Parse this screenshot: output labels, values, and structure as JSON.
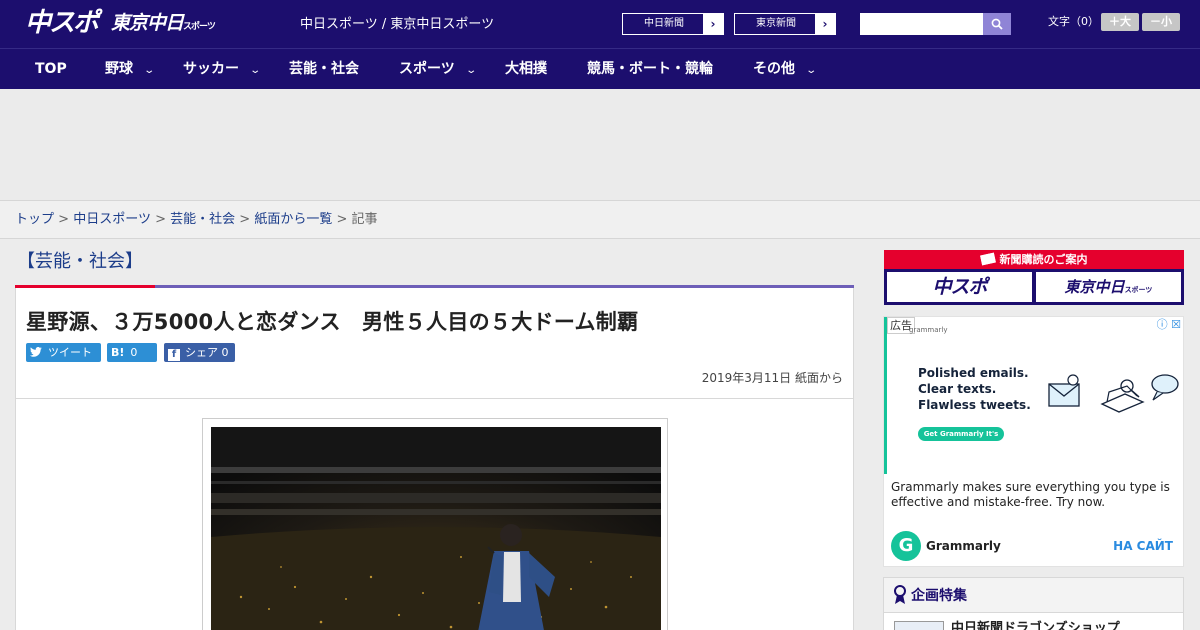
{
  "header": {
    "logo_chuspo": "中スポ",
    "logo_tokyo": "東京中日",
    "logo_tokyo_small": "スポーツ",
    "site_name": "中日スポーツ / 東京中日スポーツ",
    "paper_links": [
      "中日新聞",
      "東京新聞"
    ],
    "search_placeholder": "",
    "font_size_label": "文字（0）",
    "font_plus": "＋大",
    "font_minus": "－小"
  },
  "nav": {
    "items": [
      {
        "label": "TOP",
        "has_dropdown": false
      },
      {
        "label": "野球",
        "has_dropdown": true
      },
      {
        "label": "サッカー",
        "has_dropdown": true
      },
      {
        "label": "芸能・社会",
        "has_dropdown": false
      },
      {
        "label": "スポーツ",
        "has_dropdown": true
      },
      {
        "label": "大相撲",
        "has_dropdown": false
      },
      {
        "label": "競馬・ボート・競輪",
        "has_dropdown": false
      },
      {
        "label": "その他",
        "has_dropdown": true
      }
    ]
  },
  "breadcrumb": {
    "items": [
      "トップ",
      "中日スポーツ",
      "芸能・社会",
      "紙面から一覧"
    ],
    "separator": ">",
    "current": "記事"
  },
  "article": {
    "category": "【芸能・社会】",
    "headline": "星野源、３万5000人と恋ダンス　男性５人目の５大ドーム制覇",
    "share": {
      "tweet_label": "ツイート",
      "hatena_icon": "B!",
      "hatena_count": "0",
      "facebook_icon": "f",
      "facebook_label": "シェア",
      "facebook_count": "0"
    },
    "date": "2019年3月11日 紙面から"
  },
  "sidebar": {
    "subscription": {
      "header": "新聞購読のご案内",
      "logo_chuspo": "中スポ",
      "logo_tokyo": "東京中日",
      "logo_tokyo_small": "スポーツ"
    },
    "ad": {
      "tag": "広告",
      "brand_small": "grammarly",
      "close_label": "ⓘ ☒",
      "copy_lines": [
        "Polished emails.",
        "Clear texts.",
        "Flawless tweets."
      ],
      "cta": "Get Grammarly  It's free",
      "description": "Grammarly makes sure everything you type is effective and mistake-free. Try now.",
      "logo_letter": "G",
      "advertiser": "Grammarly",
      "link_label": "НА САЙТ"
    },
    "feature": {
      "title": "企画特集",
      "first_item": "中日新聞ドラゴンズショップ"
    }
  },
  "colors": {
    "header_bg": "#1c0e6e",
    "accent_red": "#e5002d",
    "accent_purple": "#6e5fb8",
    "link_blue": "#1c3d8a",
    "grammarly_green": "#15c39a"
  }
}
